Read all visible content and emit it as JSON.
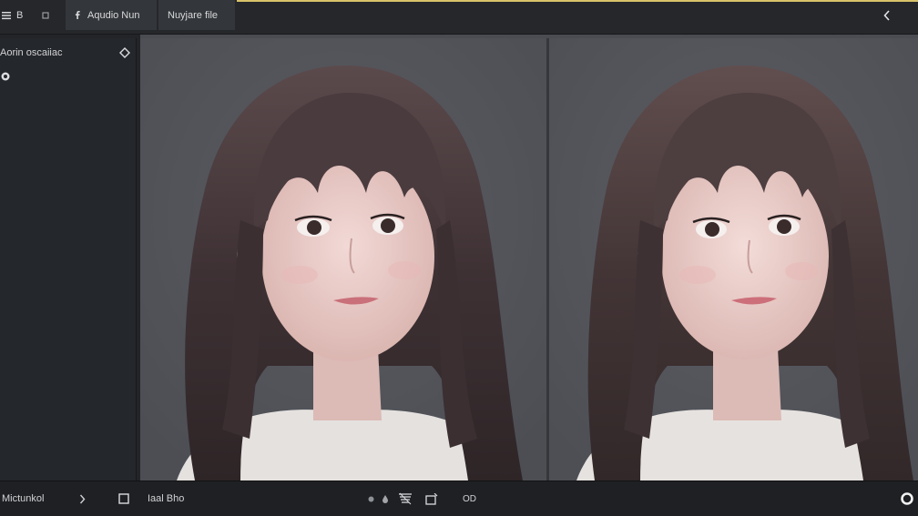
{
  "topbar": {
    "menu_icon": "hamburger-icon",
    "menu_label": "B",
    "dot_icon": "square-dot-icon",
    "tab1_icon": "facebook-icon",
    "tab1_label": "Aqudio Nun",
    "tab2_label": "Nuyjare file",
    "back_icon": "chevron-left-icon"
  },
  "sidebar": {
    "title": "Aorin oscaiiac",
    "title_icon": "diamond-icon",
    "item_icon": "radio-dot-icon"
  },
  "viewer": {
    "left_image": "portrait-girl-bangs-light-sweater",
    "right_image": "portrait-girl-bangs-light-sweater-variant"
  },
  "bottombar": {
    "left_label": "Mictunkol",
    "next_icon": "chevron-right-icon",
    "square_icon": "square-outline-icon",
    "file_label": "Iaal Bho",
    "dot_icon": "small-dot-icon",
    "drop_icon": "drop-icon",
    "layers_icon": "layers-icon",
    "frame_icon": "frame-icon",
    "zoom_label": "OD",
    "right_icon": "circle-ring-icon"
  },
  "colors": {
    "accent": "#d9c36a",
    "background": "#1f2124",
    "viewer_bg": "#515359"
  }
}
